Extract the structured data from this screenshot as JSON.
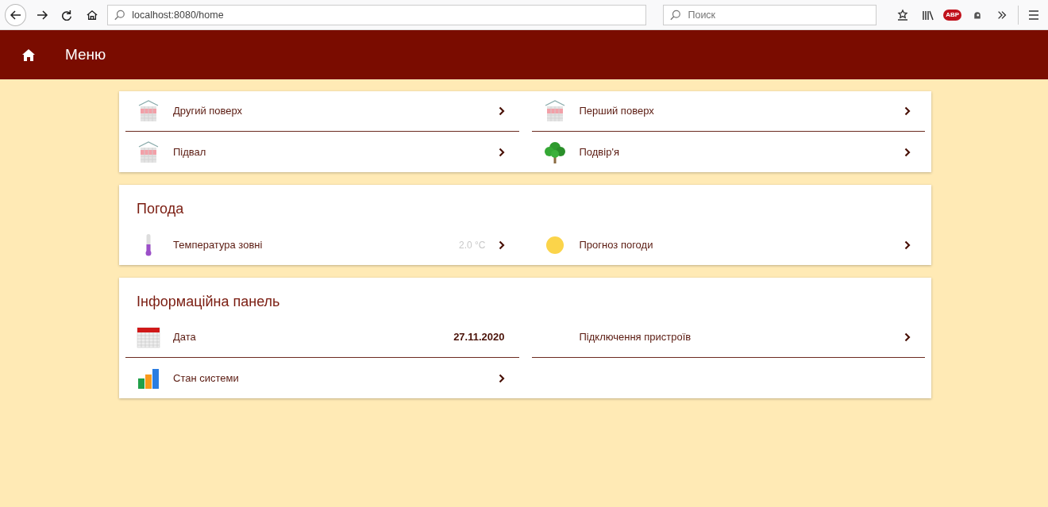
{
  "browser": {
    "url": "localhost:8080/home",
    "search": {
      "placeholder": "Поиск"
    },
    "adblock_badge": "ABP"
  },
  "app_bar": {
    "title": "Меню"
  },
  "cards": [
    {
      "items": [
        {
          "kind": "building",
          "label": "Другий поверх",
          "chevron": true
        },
        {
          "kind": "building",
          "label": "Перший поверх",
          "chevron": true
        },
        {
          "kind": "building",
          "label": "Підвал",
          "chevron": true
        },
        {
          "kind": "tree",
          "label": "Подвір'я",
          "chevron": true
        }
      ]
    },
    {
      "title": "Погода",
      "items": [
        {
          "kind": "thermometer",
          "label": "Температура зовні",
          "value": "2.0 °C",
          "value_muted": true,
          "chevron": true
        },
        {
          "kind": "sun",
          "label": "Прогноз погоди",
          "chevron": true
        }
      ]
    },
    {
      "title": "Інформаційна панель",
      "items": [
        {
          "kind": "calendar",
          "label": "Дата",
          "value": "27.11.2020",
          "value_muted": false,
          "chevron": false
        },
        {
          "kind": "none",
          "label": "Підключення пристроїв",
          "chevron": true
        },
        {
          "kind": "chart",
          "label": "Стан системи",
          "chevron": true
        }
      ]
    }
  ]
}
